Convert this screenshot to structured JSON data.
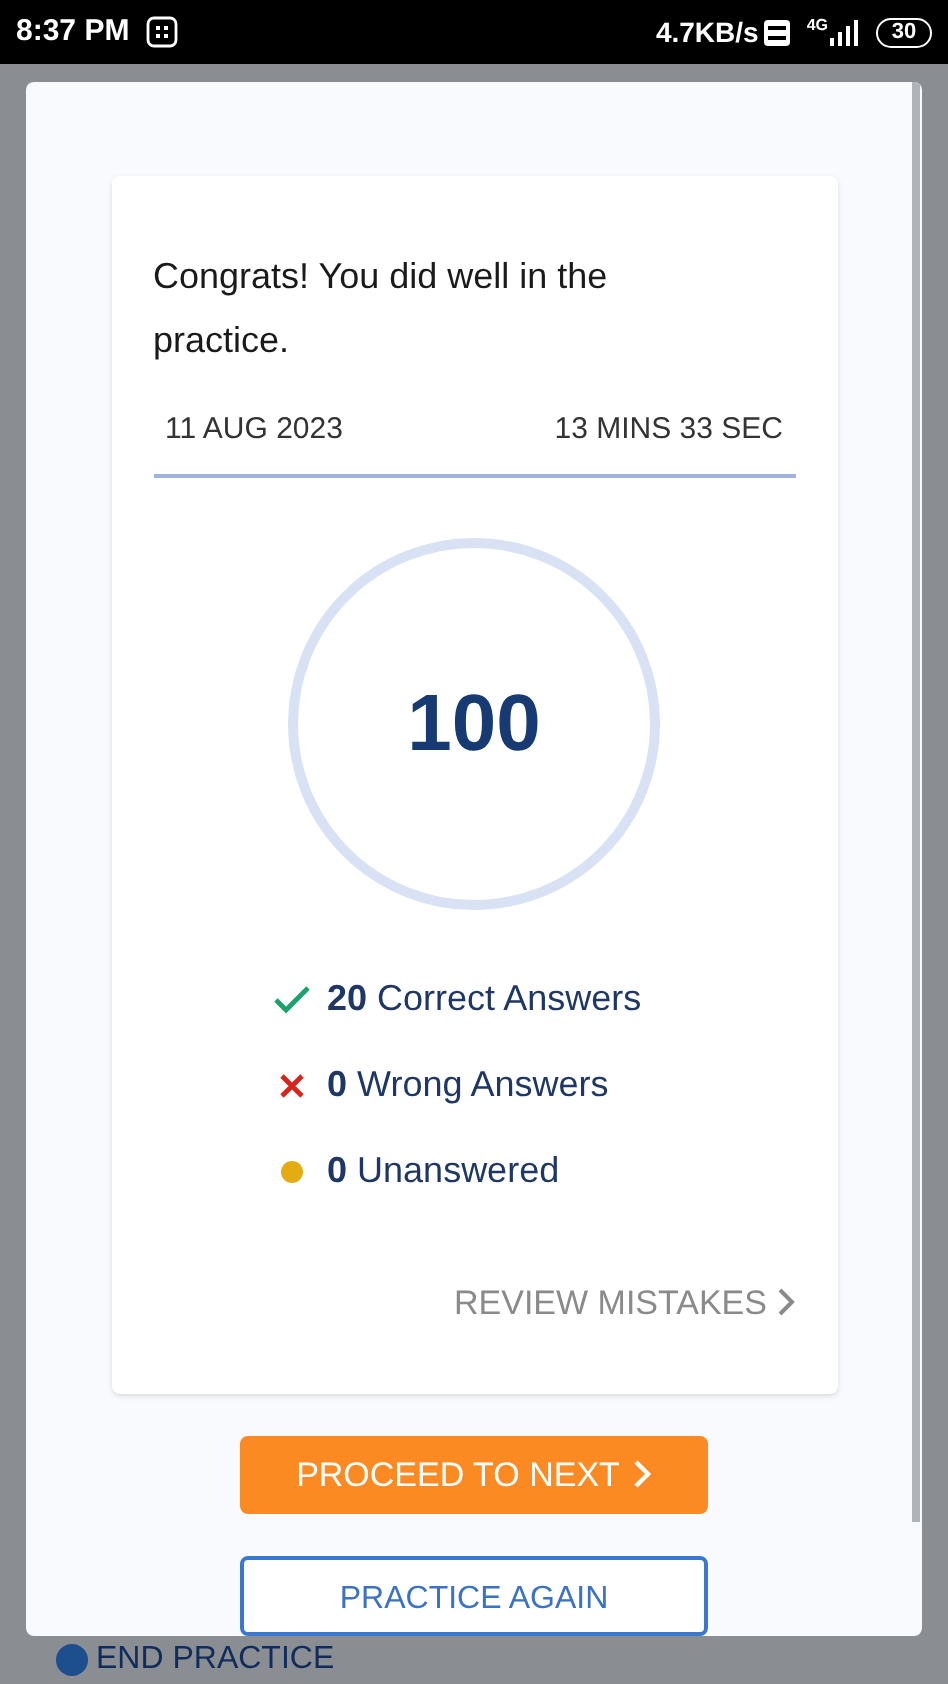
{
  "status_bar": {
    "time": "8:37 PM",
    "speed": "4.7KB/s",
    "network": "4G",
    "battery": "30"
  },
  "background": {
    "end_button": "END PRACTICE"
  },
  "result": {
    "message": "Congrats! You did well in the practice.",
    "date": "11 AUG 2023",
    "duration": "13 MINS 33 SEC",
    "score": "100",
    "stats": [
      {
        "kind": "correct",
        "count": "20",
        "label": "Correct Answers"
      },
      {
        "kind": "wrong",
        "count": "0",
        "label": "Wrong Answers"
      },
      {
        "kind": "unanswered",
        "count": "0",
        "label": "Unanswered"
      }
    ],
    "review_link": "REVIEW MISTAKES"
  },
  "buttons": {
    "proceed": "PROCEED TO NEXT",
    "practice_again": "PRACTICE AGAIN"
  }
}
